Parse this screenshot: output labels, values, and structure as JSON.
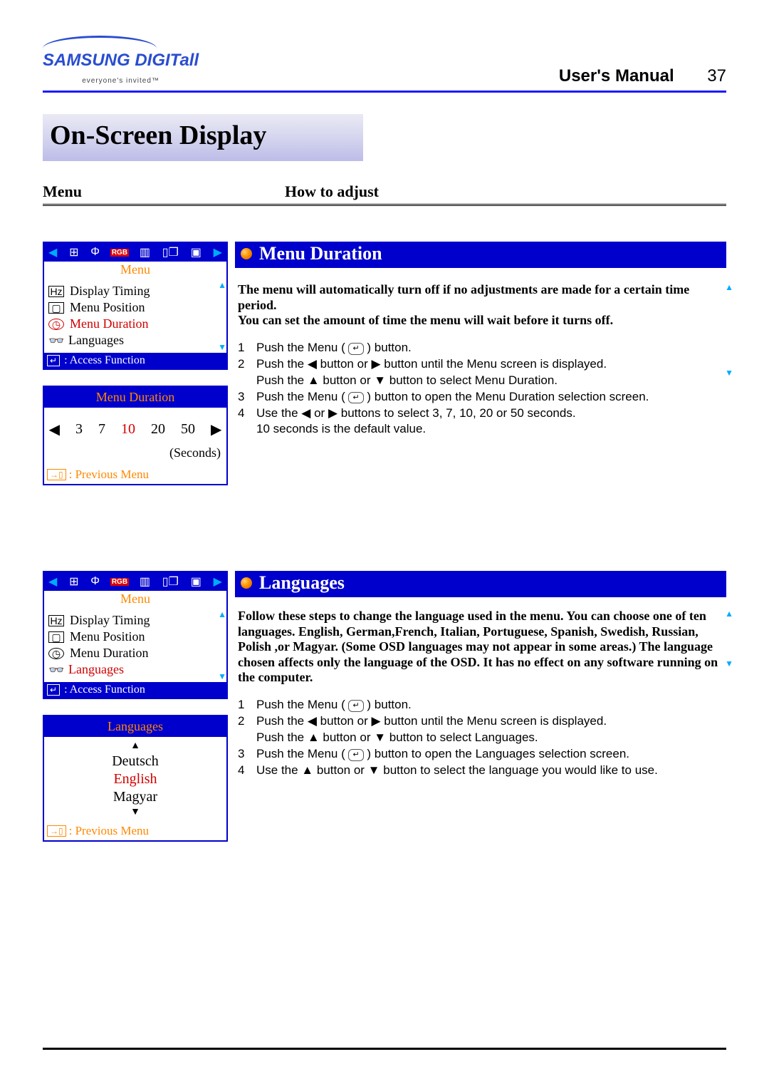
{
  "header": {
    "brand_main": "SAMSUNG DIGIT",
    "brand_suffix": "all",
    "brand_tag": "everyone's invited™",
    "doc_title": "User's Manual",
    "page_number": "37"
  },
  "page_title": "On-Screen Display",
  "col_headers": {
    "left": "Menu",
    "right": "How to adjust"
  },
  "osd_duration": {
    "top_label": "Menu",
    "items": [
      "Display Timing",
      "Menu Position",
      "Menu Duration",
      "Languages"
    ],
    "selected_index": 2,
    "access_label": ": Access Function",
    "sub_title": "Menu Duration",
    "values": [
      "3",
      "7",
      "10",
      "20",
      "50"
    ],
    "selected_value_index": 2,
    "unit": "(Seconds)",
    "prev_label": ": Previous Menu"
  },
  "osd_languages": {
    "top_label": "Menu",
    "items": [
      "Display Timing",
      "Menu Position",
      "Menu Duration",
      "Languages"
    ],
    "selected_index": 3,
    "access_label": ": Access Function",
    "sub_title": "Languages",
    "lang_options": [
      "Deutsch",
      "English",
      "Magyar"
    ],
    "selected_lang_index": 1,
    "prev_label": ": Previous Menu"
  },
  "duration_section": {
    "heading": "Menu Duration",
    "intro_bold": "The menu will automatically turn off if no adjustments are made for a certain time period.\nYou can set the amount of time the menu will wait before it turns off.",
    "steps": [
      "Push the Menu ( ↵ ) button.",
      "Push the ◀ button or ▶ button until the Menu screen is displayed.\nPush the ▲ button or ▼ button to select Menu Duration.",
      "Push the Menu ( ↵ ) button to open the Menu Duration selection screen.",
      "Use the ◀ or ▶ buttons to select 3, 7, 10, 20 or 50 seconds.\n10 seconds is the default value."
    ]
  },
  "languages_section": {
    "heading": "Languages",
    "intro_bold": "Follow these steps to change the language used in the menu. You can choose one of ten languages. English, German,French, Italian, Portuguese, Spanish, Swedish, Russian, Polish ,or Magyar.\n(Some OSD languages may not appear in some areas.)\nThe language chosen affects only the language of the OSD. It has no effect on any software running on the computer.",
    "steps": [
      "Push the Menu ( ↵ ) button.",
      "Push the ◀ button or ▶ button until the Menu screen is displayed.\nPush the ▲ button or ▼ button to select Languages.",
      "Push the Menu ( ↵ ) button to open the Languages selection screen.",
      "Use the ▲ button or ▼ button to select the language you would like to use."
    ]
  },
  "glyphs": {
    "left": "◀",
    "right": "▶",
    "up": "▲",
    "down": "▼",
    "enter": "↵",
    "exit": "→▯",
    "eye": "👁",
    "hz": "Hz",
    "clock": "◷",
    "pos": "▢"
  }
}
